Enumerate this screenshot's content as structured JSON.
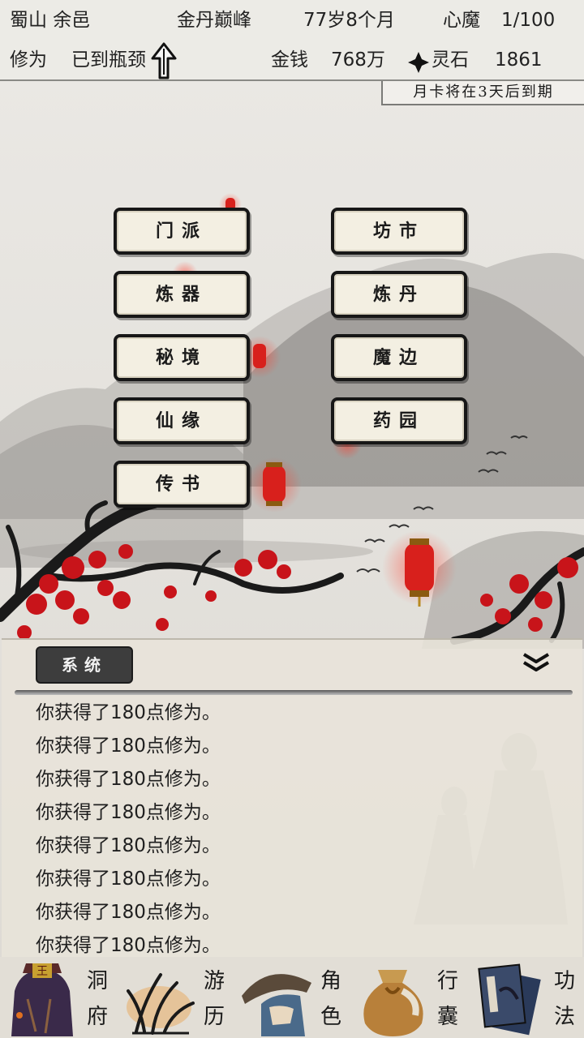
{
  "status": {
    "location": "蜀山 余邑",
    "realm": "金丹巅峰",
    "age": "77岁8个月",
    "heart_demon_label": "心魔",
    "heart_demon_value": "1/100",
    "cultivation_label": "修为",
    "cultivation_value": "已到瓶颈",
    "money_label": "金钱",
    "money_value": "768万",
    "spirit_stone_label": "灵石",
    "spirit_stone_value": "1861"
  },
  "notice": "月卡将在3天后到期",
  "menu": [
    {
      "label": "门派"
    },
    {
      "label": "坊市"
    },
    {
      "label": "炼器"
    },
    {
      "label": "炼丹"
    },
    {
      "label": "秘境"
    },
    {
      "label": "魔边"
    },
    {
      "label": "仙缘"
    },
    {
      "label": "药园"
    },
    {
      "label": "传书"
    }
  ],
  "log": {
    "tab_label": "系统",
    "lines": [
      "你获得了180点修为。",
      "你获得了180点修为。",
      "你获得了180点修为。",
      "你获得了180点修为。",
      "你获得了180点修为。",
      "你获得了180点修为。",
      "你获得了180点修为。",
      "你获得了180点修为。"
    ]
  },
  "nav": [
    {
      "label": "洞府",
      "icon": "cave-icon"
    },
    {
      "label": "游历",
      "icon": "travel-icon"
    },
    {
      "label": "角色",
      "icon": "character-icon"
    },
    {
      "label": "行囊",
      "icon": "bag-icon"
    },
    {
      "label": "功法",
      "icon": "book-icon"
    }
  ],
  "colors": {
    "lantern": "#d8201c",
    "blossom": "#c8141a",
    "button_bg": "#f3efe2",
    "button_border": "#171717"
  }
}
